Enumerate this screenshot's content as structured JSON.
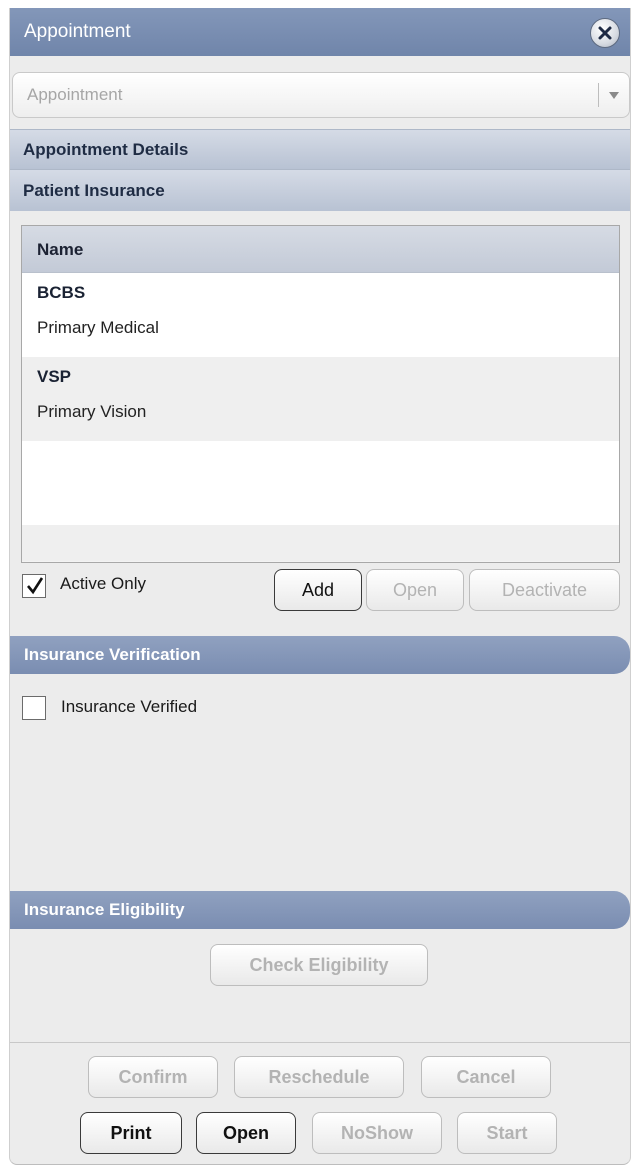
{
  "window": {
    "title": "Appointment"
  },
  "type_select": {
    "value": "Appointment"
  },
  "sections": {
    "appointment_details": "Appointment Details",
    "patient_insurance": "Patient Insurance",
    "insurance_verification": "Insurance Verification",
    "insurance_eligibility": "Insurance Eligibility"
  },
  "insurance_list": {
    "column_header": "Name",
    "rows": [
      {
        "name": "BCBS",
        "type": "Primary Medical"
      },
      {
        "name": "VSP",
        "type": "Primary Vision"
      }
    ]
  },
  "active_only": {
    "label": "Active Only",
    "checked": true
  },
  "list_buttons": {
    "add": "Add",
    "open": "Open",
    "deactivate": "Deactivate"
  },
  "verification": {
    "label": "Insurance Verified",
    "checked": false
  },
  "eligibility": {
    "check_button": "Check Eligibility"
  },
  "footer": {
    "confirm": "Confirm",
    "reschedule": "Reschedule",
    "cancel": "Cancel",
    "print": "Print",
    "open": "Open",
    "noshow": "NoShow",
    "start": "Start"
  },
  "colors": {
    "header_blue": "#7a8db1",
    "panel_bg": "#ececec"
  },
  "icons": {
    "close": "close-icon",
    "dropdown": "chevron-down-icon",
    "check": "checkmark-icon"
  }
}
